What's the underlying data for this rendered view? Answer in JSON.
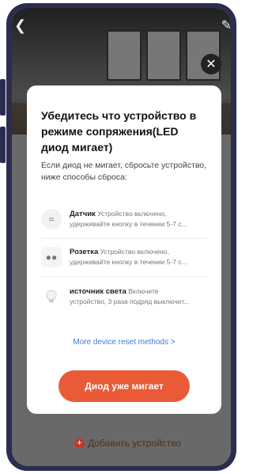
{
  "header": {
    "back_icon": "back-arrow-icon",
    "edit_icon": "edit-pencil-icon"
  },
  "modal": {
    "close_icon": "close-icon",
    "title": "Убедитесь что устройство в режиме сопряжения(LED диод мигает)",
    "subtitle": "Если диод не мигает, сбросьте устройство, ниже способы сброса:",
    "methods": [
      {
        "icon": "sensor-icon",
        "name": "Датчик",
        "line1": "Устройство включено,",
        "line2": "удерживайте кнопку в течении 5-7 с..."
      },
      {
        "icon": "socket-icon",
        "name": "Розетка",
        "line1": "Устройство включено,",
        "line2": "удерживайте кнопку в течении 5-7 с..."
      },
      {
        "icon": "bulb-icon",
        "name": "источник света",
        "line1": "Включите",
        "line2": "устройство, 3 раза подряд выключит..."
      }
    ],
    "more_link": "More device reset methods >",
    "primary_button": "Диод уже мигает"
  },
  "bottom": {
    "add_device_label": "Добавить устройство",
    "add_icon": "plus-icon"
  },
  "colors": {
    "accent": "#ea5a37",
    "link": "#3b7bd5",
    "phone_frame": "#2b2d4f"
  }
}
